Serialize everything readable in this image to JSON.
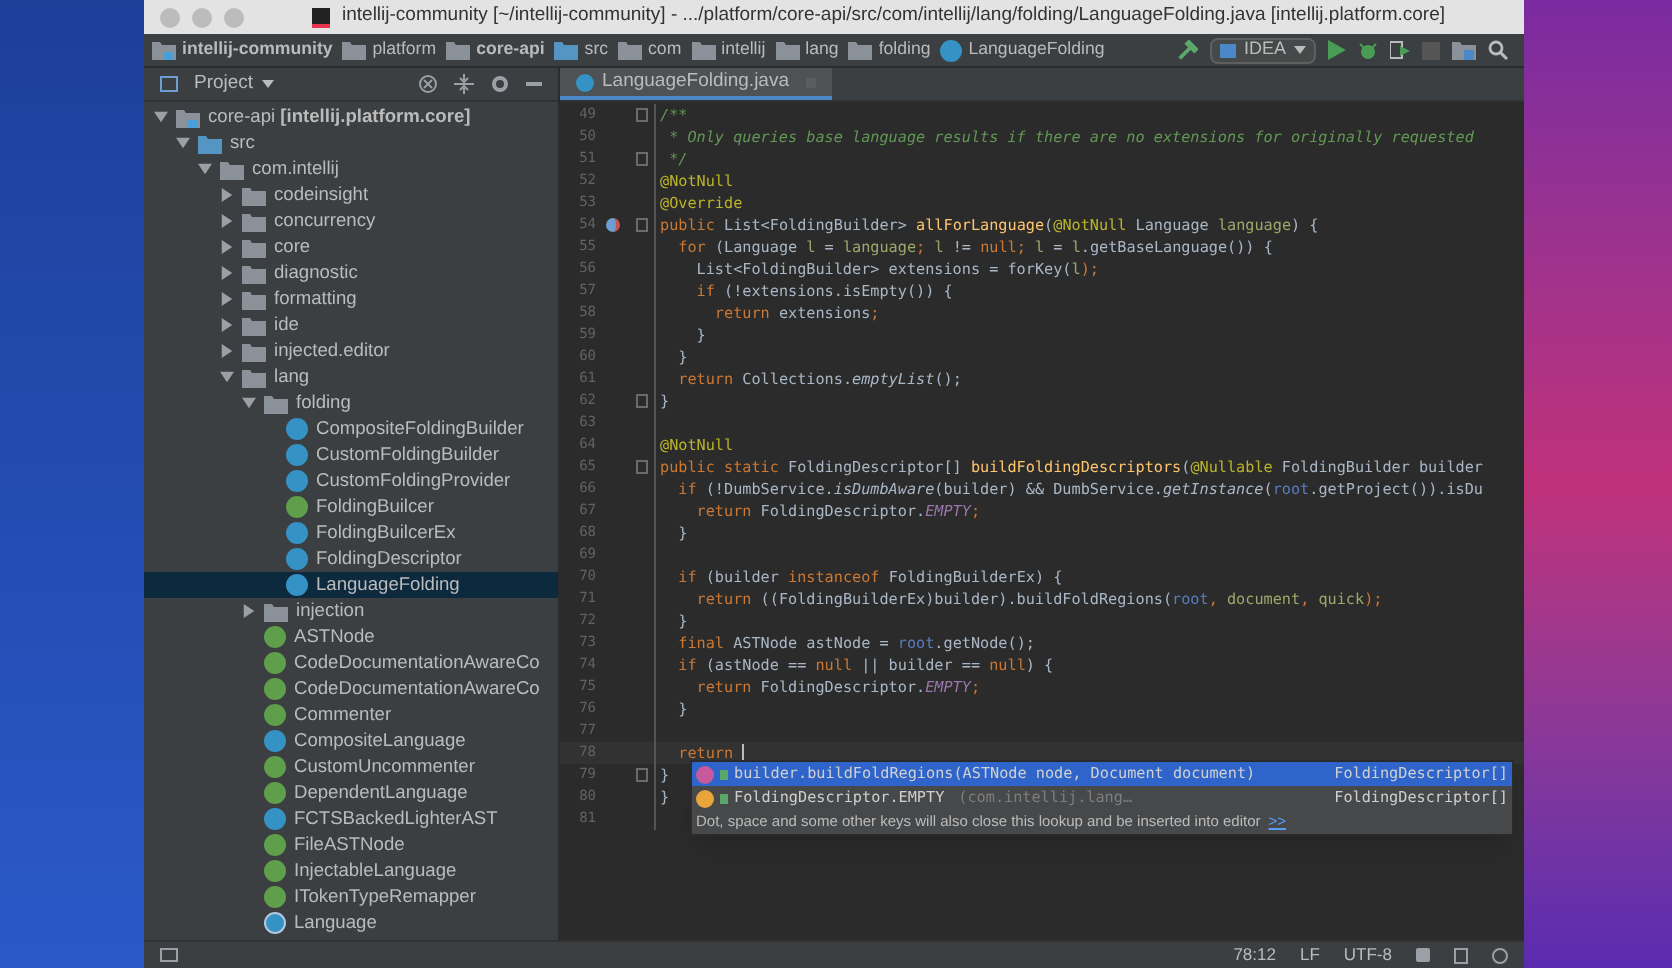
{
  "window": {
    "title": "intellij-community [~/intellij-community] - .../platform/core-api/src/com/intellij/lang/folding/LanguageFolding.java [intellij.platform.core]"
  },
  "breadcrumbs": [
    {
      "label": "intellij-community",
      "kind": "module",
      "bold": true
    },
    {
      "label": "platform",
      "kind": "folder",
      "bold": false
    },
    {
      "label": "core-api",
      "kind": "folder",
      "bold": true
    },
    {
      "label": "src",
      "kind": "source",
      "bold": false
    },
    {
      "label": "com",
      "kind": "folder",
      "bold": false
    },
    {
      "label": "intellij",
      "kind": "folder",
      "bold": false
    },
    {
      "label": "lang",
      "kind": "folder",
      "bold": false
    },
    {
      "label": "folding",
      "kind": "folder",
      "bold": false
    },
    {
      "label": "LanguageFolding",
      "kind": "class",
      "bold": false
    }
  ],
  "run_config": {
    "label": "IDEA"
  },
  "project_panel": {
    "title": "Project",
    "tree": [
      {
        "label": "core-api **[intellij.platform.core]**",
        "kind": "module",
        "expanded": true,
        "selected": false,
        "children": [
          {
            "label": "src",
            "kind": "source",
            "expanded": true,
            "selected": false,
            "children": [
              {
                "label": "com.intellij",
                "kind": "package",
                "expanded": true,
                "selected": false,
                "children": [
                  {
                    "label": "codeinsight",
                    "kind": "package",
                    "expanded": false,
                    "selected": false
                  },
                  {
                    "label": "concurrency",
                    "kind": "package",
                    "expanded": false,
                    "selected": false
                  },
                  {
                    "label": "core",
                    "kind": "package",
                    "expanded": false,
                    "selected": false
                  },
                  {
                    "label": "diagnostic",
                    "kind": "package",
                    "expanded": false,
                    "selected": false
                  },
                  {
                    "label": "formatting",
                    "kind": "package",
                    "expanded": false,
                    "selected": false
                  },
                  {
                    "label": "ide",
                    "kind": "package",
                    "expanded": false,
                    "selected": false
                  },
                  {
                    "label": "injected.editor",
                    "kind": "package",
                    "expanded": false,
                    "selected": false
                  },
                  {
                    "label": "lang",
                    "kind": "package",
                    "expanded": true,
                    "selected": false,
                    "children": [
                      {
                        "label": "folding",
                        "kind": "package",
                        "expanded": true,
                        "selected": false,
                        "children": [
                          {
                            "label": "CompositeFoldingBuilder",
                            "kind": "class",
                            "selected": false
                          },
                          {
                            "label": "CustomFoldingBuilder",
                            "kind": "class",
                            "selected": false
                          },
                          {
                            "label": "CustomFoldingProvider",
                            "kind": "class",
                            "selected": false
                          },
                          {
                            "label": "FoldingBuilcer",
                            "kind": "interface",
                            "selected": false
                          },
                          {
                            "label": "FoldingBuilcerEx",
                            "kind": "class",
                            "selected": false
                          },
                          {
                            "label": "FoldingDescriptor",
                            "kind": "class",
                            "selected": false
                          },
                          {
                            "label": "LanguageFolding",
                            "kind": "class",
                            "selected": true
                          }
                        ]
                      },
                      {
                        "label": "injection",
                        "kind": "package",
                        "expanded": false,
                        "selected": false
                      },
                      {
                        "label": "ASTNode",
                        "kind": "interface",
                        "selected": false
                      },
                      {
                        "label": "CodeDocumentationAwareCo",
                        "kind": "interface",
                        "selected": false
                      },
                      {
                        "label": "CodeDocumentationAwareCo",
                        "kind": "interface",
                        "selected": false
                      },
                      {
                        "label": "Commenter",
                        "kind": "interface",
                        "selected": false
                      },
                      {
                        "label": "CompositeLanguage",
                        "kind": "class",
                        "selected": false
                      },
                      {
                        "label": "CustomUncommenter",
                        "kind": "interface",
                        "selected": false
                      },
                      {
                        "label": "DependentLanguage",
                        "kind": "interface",
                        "selected": false
                      },
                      {
                        "label": "FCTSBackedLighterAST",
                        "kind": "class",
                        "selected": false
                      },
                      {
                        "label": "FileASTNode",
                        "kind": "interface",
                        "selected": false
                      },
                      {
                        "label": "InjectableLanguage",
                        "kind": "interface",
                        "selected": false
                      },
                      {
                        "label": "ITokenTypeRemapper",
                        "kind": "interface",
                        "selected": false
                      },
                      {
                        "label": "Language",
                        "kind": "abstract-class",
                        "selected": false
                      }
                    ]
                  }
                ]
              }
            ]
          }
        ]
      }
    ]
  },
  "editor": {
    "tabs": [
      {
        "label": "LanguageFolding.java",
        "selected": true
      }
    ],
    "lines": [
      {
        "number": "49",
        "fold": true,
        "current": false,
        "tokens": [
          {
            "text": "/**",
            "kind": "comment"
          }
        ]
      },
      {
        "number": "50",
        "fold": false,
        "current": false,
        "tokens": [
          {
            "text": " * Only queries base language results if there are no extensions for originally requested",
            "kind": "comment"
          }
        ]
      },
      {
        "number": "51",
        "fold": true,
        "current": false,
        "tokens": [
          {
            "text": " */",
            "kind": "comment"
          }
        ]
      },
      {
        "number": "52",
        "fold": false,
        "current": false,
        "tokens": [
          {
            "text": "@NotNull",
            "kind": "annotation"
          }
        ]
      },
      {
        "number": "53",
        "fold": false,
        "current": false,
        "tokens": [
          {
            "text": "@Override",
            "kind": "annotation"
          }
        ]
      },
      {
        "number": "54",
        "fold": true,
        "current": false,
        "override": true,
        "tokens": [
          {
            "text": "public ",
            "kind": "keyword"
          },
          {
            "text": "List<FoldingBuilder> ",
            "kind": "plain"
          },
          {
            "text": "allForLanguage",
            "kind": "decl"
          },
          {
            "text": "(",
            "kind": "plain"
          },
          {
            "text": "@NotNull ",
            "kind": "annotation"
          },
          {
            "text": "Language ",
            "kind": "plain"
          },
          {
            "text": "language",
            "kind": "param"
          },
          {
            "text": ") {",
            "kind": "plain"
          }
        ]
      },
      {
        "number": "55",
        "fold": false,
        "current": false,
        "tokens": [
          {
            "text": "  for ",
            "kind": "keyword"
          },
          {
            "text": "(Language ",
            "kind": "plain"
          },
          {
            "text": "l",
            "kind": "param"
          },
          {
            "text": " = ",
            "kind": "plain"
          },
          {
            "text": "language",
            "kind": "param"
          },
          {
            "text": "; ",
            "kind": "keyword"
          },
          {
            "text": "l",
            "kind": "param"
          },
          {
            "text": " != ",
            "kind": "plain"
          },
          {
            "text": "null",
            "kind": "keyword"
          },
          {
            "text": "; ",
            "kind": "keyword"
          },
          {
            "text": "l",
            "kind": "param"
          },
          {
            "text": " = ",
            "kind": "plain"
          },
          {
            "text": "l",
            "kind": "param"
          },
          {
            "text": ".getBaseLanguage()) {",
            "kind": "plain"
          }
        ]
      },
      {
        "number": "56",
        "fold": false,
        "current": false,
        "tokens": [
          {
            "text": "    List<FoldingBuilder> extensions = forKey(",
            "kind": "plain"
          },
          {
            "text": "l",
            "kind": "param"
          },
          {
            "text": ");",
            "kind": "keyword"
          }
        ]
      },
      {
        "number": "57",
        "fold": false,
        "current": false,
        "tokens": [
          {
            "text": "    if ",
            "kind": "keyword"
          },
          {
            "text": "(!extensions.isEmpty()) {",
            "kind": "plain"
          }
        ]
      },
      {
        "number": "58",
        "fold": false,
        "current": false,
        "tokens": [
          {
            "text": "      return ",
            "kind": "keyword"
          },
          {
            "text": "extensions",
            "kind": "plain"
          },
          {
            "text": ";",
            "kind": "keyword"
          }
        ]
      },
      {
        "number": "59",
        "fold": false,
        "current": false,
        "tokens": [
          {
            "text": "    }",
            "kind": "plain"
          }
        ]
      },
      {
        "number": "60",
        "fold": false,
        "current": false,
        "tokens": [
          {
            "text": "  }",
            "kind": "plain"
          }
        ]
      },
      {
        "number": "61",
        "fold": false,
        "current": false,
        "tokens": [
          {
            "text": "  return ",
            "kind": "keyword"
          },
          {
            "text": "Collections.",
            "kind": "plain"
          },
          {
            "text": "emptyList",
            "kind": "static"
          },
          {
            "text": "();",
            "kind": "plain"
          }
        ]
      },
      {
        "number": "62",
        "fold": true,
        "current": false,
        "tokens": [
          {
            "text": "}",
            "kind": "plain"
          }
        ]
      },
      {
        "number": "63",
        "fold": false
      },
      {
        "number": "64",
        "fold": false,
        "current": false,
        "tokens": [
          {
            "text": "@NotNull",
            "kind": "annotation"
          }
        ]
      },
      {
        "number": "65",
        "fold": true,
        "current": false,
        "tokens": [
          {
            "text": "public static ",
            "kind": "keyword"
          },
          {
            "text": "FoldingDescriptor[] ",
            "kind": "plain"
          },
          {
            "text": "buildFoldingDescriptors",
            "kind": "decl"
          },
          {
            "text": "(",
            "kind": "plain"
          },
          {
            "text": "@Nullable ",
            "kind": "annotation"
          },
          {
            "text": "FoldingBuilder builder",
            "kind": "plain"
          }
        ]
      },
      {
        "number": "66",
        "fold": false,
        "current": false,
        "tokens": [
          {
            "text": "  if ",
            "kind": "keyword"
          },
          {
            "text": "(!DumbService.",
            "kind": "plain"
          },
          {
            "text": "isDumbAware",
            "kind": "static"
          },
          {
            "text": "(builder) && DumbService.",
            "kind": "plain"
          },
          {
            "text": "getInstance",
            "kind": "static"
          },
          {
            "text": "(",
            "kind": "plain"
          },
          {
            "text": "root",
            "kind": "root"
          },
          {
            "text": ".getProject()).isDu",
            "kind": "plain"
          }
        ]
      },
      {
        "number": "67",
        "fold": false,
        "current": false,
        "tokens": [
          {
            "text": "    return ",
            "kind": "keyword"
          },
          {
            "text": "FoldingDescriptor.",
            "kind": "plain"
          },
          {
            "text": "EMPTY",
            "kind": "constant"
          },
          {
            "text": ";",
            "kind": "keyword"
          }
        ]
      },
      {
        "number": "68",
        "fold": false,
        "current": false,
        "tokens": [
          {
            "text": "  }",
            "kind": "plain"
          }
        ]
      },
      {
        "number": "69",
        "fold": false
      },
      {
        "number": "70",
        "fold": false,
        "current": false,
        "tokens": [
          {
            "text": "  if ",
            "kind": "keyword"
          },
          {
            "text": "(builder ",
            "kind": "plain"
          },
          {
            "text": "instanceof ",
            "kind": "keyword"
          },
          {
            "text": "FoldingBuilderEx) {",
            "kind": "plain"
          }
        ]
      },
      {
        "number": "71",
        "fold": false,
        "current": false,
        "tokens": [
          {
            "text": "    return ",
            "kind": "keyword"
          },
          {
            "text": "((FoldingBuilderEx)builder).buildFoldRegions(",
            "kind": "plain"
          },
          {
            "text": "root",
            "kind": "root"
          },
          {
            "text": ", ",
            "kind": "keyword"
          },
          {
            "text": "document",
            "kind": "param"
          },
          {
            "text": ", ",
            "kind": "keyword"
          },
          {
            "text": "quick",
            "kind": "param"
          },
          {
            "text": ");",
            "kind": "keyword"
          }
        ]
      },
      {
        "number": "72",
        "fold": false,
        "current": false,
        "tokens": [
          {
            "text": "  }",
            "kind": "plain"
          }
        ]
      },
      {
        "number": "73",
        "fold": false,
        "current": false,
        "tokens": [
          {
            "text": "  final ",
            "kind": "keyword"
          },
          {
            "text": "ASTNode astNode = ",
            "kind": "plain"
          },
          {
            "text": "root",
            "kind": "root"
          },
          {
            "text": ".getNode();",
            "kind": "plain"
          }
        ]
      },
      {
        "number": "74",
        "fold": false,
        "current": false,
        "tokens": [
          {
            "text": "  if ",
            "kind": "keyword"
          },
          {
            "text": "(astNode == ",
            "kind": "plain"
          },
          {
            "text": "null ",
            "kind": "keyword"
          },
          {
            "text": "|| builder == ",
            "kind": "plain"
          },
          {
            "text": "null",
            "kind": "keyword"
          },
          {
            "text": ") {",
            "kind": "plain"
          }
        ]
      },
      {
        "number": "75",
        "fold": false,
        "current": false,
        "tokens": [
          {
            "text": "    return ",
            "kind": "keyword"
          },
          {
            "text": "FoldingDescriptor.",
            "kind": "plain"
          },
          {
            "text": "EMPTY",
            "kind": "constant"
          },
          {
            "text": ";",
            "kind": "keyword"
          }
        ]
      },
      {
        "number": "76",
        "fold": false,
        "current": false,
        "tokens": [
          {
            "text": "  }",
            "kind": "plain"
          }
        ]
      },
      {
        "number": "77",
        "fold": false
      },
      {
        "number": "78",
        "fold": false,
        "current": true,
        "tokens": [
          {
            "text": "  return ",
            "kind": "keyword"
          }
        ]
      },
      {
        "number": "79",
        "fold": true,
        "tokens": [
          {
            "text": "}",
            "kind": "plain"
          }
        ]
      },
      {
        "number": "80",
        "fold": false,
        "tokens": [
          {
            "text": "}",
            "kind": "plain"
          }
        ]
      },
      {
        "number": "81",
        "fold": false
      }
    ],
    "completion": {
      "items": [
        {
          "kind": "method",
          "text": "builder.buildFoldRegions(ASTNode node, Document document)",
          "type": "FoldingDescriptor[]",
          "selected": true
        },
        {
          "kind": "field",
          "text": "FoldingDescriptor.EMPTY",
          "hint": "(com.intellij.lang…",
          "type": "FoldingDescriptor[]",
          "selected": false
        }
      ],
      "footer": "Dot, space and some other keys will also close this lookup and be inserted into editor",
      "footer_link": ">>"
    }
  },
  "status_bar": {
    "position": "78:12",
    "line_separator": "LF",
    "encoding": "UTF-8"
  }
}
